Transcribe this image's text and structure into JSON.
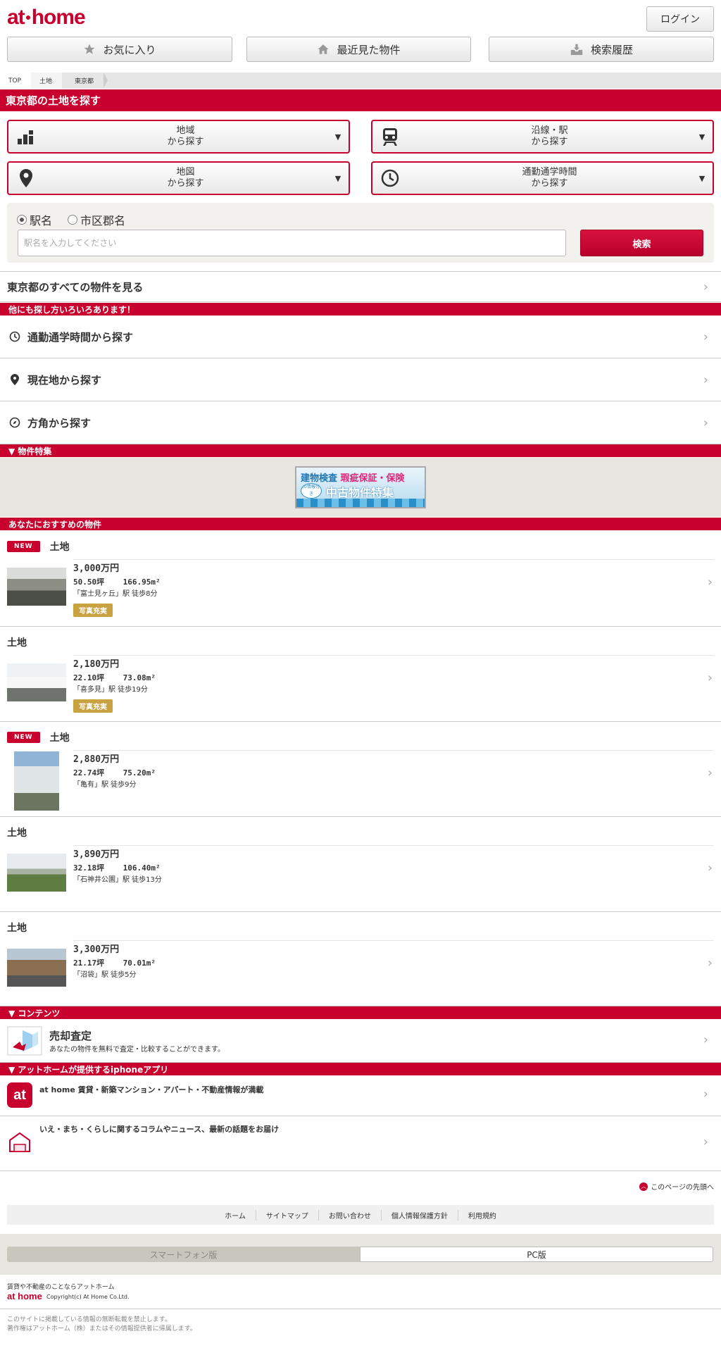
{
  "header": {
    "logo_text_a": "at",
    "logo_text_b": "home",
    "login_label": "ログイン"
  },
  "topnav": {
    "favorites_label": "お気に入り",
    "recent_label": "最近見た物件",
    "history_label": "検索履歴"
  },
  "breadcrumb": [
    "TOP",
    "土地",
    "東京都"
  ],
  "search": {
    "title": "東京都の土地を探す",
    "region": {
      "line1": "地域",
      "line2": "から探す"
    },
    "line": {
      "line1": "沿線・駅",
      "line2": "から探す"
    },
    "map": {
      "line1": "地図",
      "line2": "から探す"
    },
    "commute": {
      "line1": "通勤通学時間",
      "line2": "から探す"
    },
    "radio_station": "駅名",
    "radio_city": "市区郡名",
    "placeholder": "駅名を入力してください",
    "submit_label": "検索"
  },
  "all_link": "東京都のすべての物件を見る",
  "other_ways": {
    "title": "他にも探し方いろいろあります！",
    "items": [
      "通勤通学時間から探す",
      "現在地から探す",
      "方角から探す"
    ]
  },
  "feature": {
    "title": "▼ 物件特集",
    "banner_line1a": "建物検査",
    "banner_line1b": "瑕疵保証・保険",
    "banner_line2": "中古物件特集",
    "banner_seal": "の情報付き"
  },
  "recommend": {
    "title": "あなたにおすすめの物件",
    "new_badge": "NEW",
    "photo_tag": "写真充実",
    "items": [
      {
        "is_new": true,
        "type": "土地",
        "price": "3,000万円",
        "area": "50.50坪    166.95m²",
        "station": "「富士見ヶ丘」駅 徒歩8分",
        "photo_rich": true
      },
      {
        "is_new": false,
        "type": "土地",
        "price": "2,180万円",
        "area": "22.10坪    73.08m²",
        "station": "「喜多見」駅 徒歩19分",
        "photo_rich": true
      },
      {
        "is_new": true,
        "type": "土地",
        "price": "2,880万円",
        "area": "22.74坪    75.20m²",
        "station": "「亀有」駅 徒歩9分",
        "photo_rich": false
      },
      {
        "is_new": false,
        "type": "土地",
        "price": "3,890万円",
        "area": "32.18坪    106.40m²",
        "station": "「石神井公園」駅 徒歩13分",
        "photo_rich": false
      },
      {
        "is_new": false,
        "type": "土地",
        "price": "3,300万円",
        "area": "21.17坪    70.01m²",
        "station": "「沼袋」駅 徒歩5分",
        "photo_rich": false
      }
    ]
  },
  "contents": {
    "title": "▼ コンテンツ",
    "sell_title": "売却査定",
    "sell_desc": "あなたの物件を無料で査定・比較することができます。"
  },
  "apps": {
    "title": "▼ アットホームが提供するiphoneアプリ",
    "app1_icon": "at",
    "app1_text": "at home 賃貸・新築マンション・アパート・不動産情報が満載",
    "app2_text": "いえ・まち・くらしに関するコラムやニュース、最新の話題をお届け"
  },
  "footer": {
    "to_top": "このページの先頭へ",
    "links": [
      "ホーム",
      "サイトマップ",
      "お問い合わせ",
      "個人情報保護方針",
      "利用規約"
    ],
    "sp_label": "スマートフォン版",
    "pc_label": "PC版",
    "tagline": "賃貸や不動産のことならアットホーム",
    "logo": "at home",
    "copyright": "Copyright(c) At Home Co.Ltd.",
    "notice1": "このサイトに掲載している情報の無断転載を禁止します。",
    "notice2": "著作権はアットホーム（株）またはその情報提供者に帰属します。"
  },
  "colors": {
    "brand_red": "#c8002e",
    "tag_gold": "#c9a242",
    "beige_bg": "#e8e6e1"
  }
}
